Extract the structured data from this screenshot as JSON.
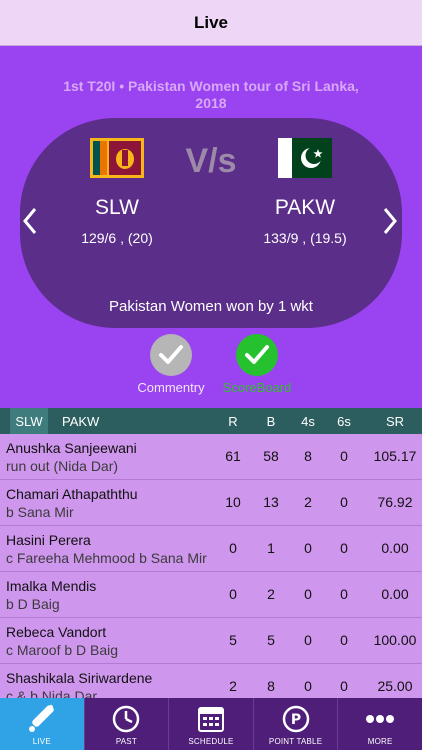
{
  "header": {
    "title": "Live"
  },
  "match": {
    "title": "1st T20I • Pakistan Women tour of Sri Lanka, 2018",
    "vs": "V/s",
    "team_a": {
      "name": "SLW",
      "score": "129/6 , (20)"
    },
    "team_b": {
      "name": "PAKW",
      "score": "133/9 , (19.5)"
    },
    "result": "Pakistan Women won by 1 wkt"
  },
  "toggles": {
    "commentary": "Commentry",
    "scoreboard": "ScoreBoard"
  },
  "scorecard": {
    "tabs": [
      "SLW",
      "PAKW"
    ],
    "columns": [
      "R",
      "B",
      "4s",
      "6s",
      "SR"
    ],
    "rows": [
      {
        "name": "Anushka Sanjeewani",
        "dismissal": "run out (Nida Dar)",
        "r": "61",
        "b": "58",
        "fours": "8",
        "sixes": "0",
        "sr": "105.17"
      },
      {
        "name": "Chamari Athapaththu",
        "dismissal": "b Sana Mir",
        "r": "10",
        "b": "13",
        "fours": "2",
        "sixes": "0",
        "sr": "76.92"
      },
      {
        "name": "Hasini Perera",
        "dismissal": "c Fareeha Mehmood b Sana Mir",
        "r": "0",
        "b": "1",
        "fours": "0",
        "sixes": "0",
        "sr": "0.00"
      },
      {
        "name": "Imalka Mendis",
        "dismissal": "b D Baig",
        "r": "0",
        "b": "2",
        "fours": "0",
        "sixes": "0",
        "sr": "0.00"
      },
      {
        "name": "Rebeca Vandort",
        "dismissal": "c Maroof b D Baig",
        "r": "5",
        "b": "5",
        "fours": "0",
        "sixes": "0",
        "sr": "100.00"
      },
      {
        "name": "Shashikala Siriwardene",
        "dismissal": "c & b Nida Dar",
        "r": "2",
        "b": "8",
        "fours": "0",
        "sixes": "0",
        "sr": "25.00"
      }
    ]
  },
  "tabbar": {
    "items": [
      {
        "label": "LIVE",
        "icon": "cricket-bat-icon"
      },
      {
        "label": "PAST",
        "icon": "clock-icon"
      },
      {
        "label": "SCHEDULE",
        "icon": "calendar-icon"
      },
      {
        "label": "POINT TABLE",
        "icon": "points-icon"
      },
      {
        "label": "MORE",
        "icon": "more-icon"
      }
    ]
  },
  "colors": {
    "hero": "#9a43f0",
    "oval": "#5b2e8a",
    "table_header": "#2c5e5f",
    "tab_active": "#2fa3e5",
    "tabbar": "#4f1e79"
  }
}
